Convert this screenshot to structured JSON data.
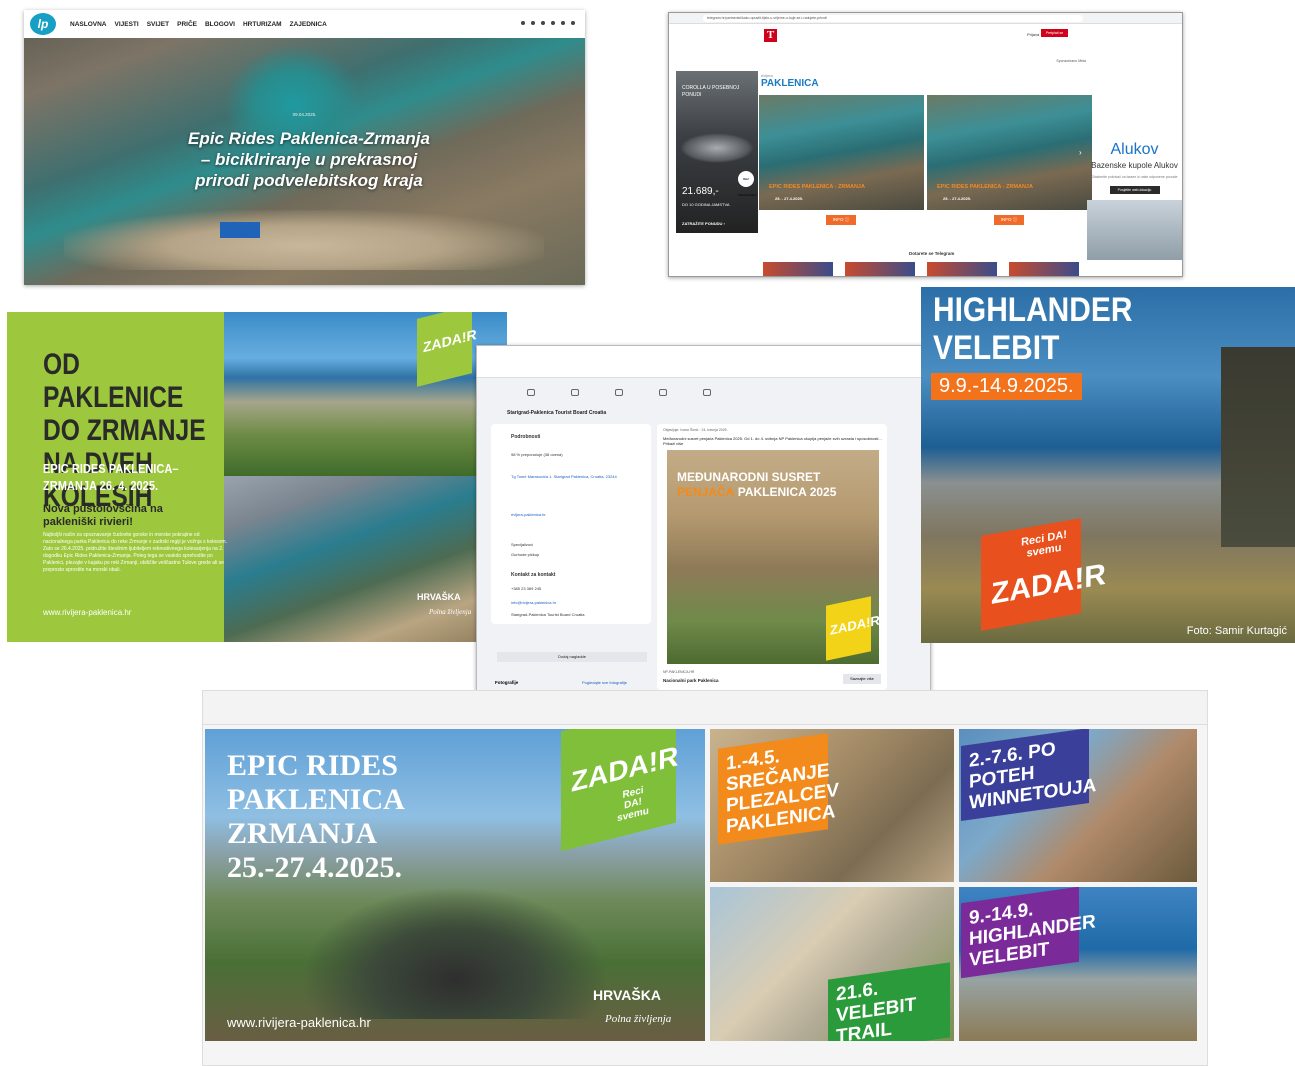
{
  "news_site": {
    "logo": "lp",
    "nav": [
      "NASLOVNA",
      "VIJESTI",
      "SVIJET",
      "PRIČE",
      "BLOGOVI",
      "HRTURIZAM",
      "ZAJEDNICA"
    ],
    "date": "09.04.2025.",
    "headline": "Epic Rides Paklenica-Zrmanja – biciklriranje u prekrasnoj prirodi podvelebitskog kraja"
  },
  "browser_ad_page": {
    "url": "telegram.hr/partnerski/kako-opustit-tijelo-u-vrijeme-u-koje-se-i-radujete-prirodi",
    "login": "Prijava",
    "subscribe": "Pretplati se",
    "sponsored": "Sponzorirano Meta",
    "toyota": {
      "model": "COROLLA U POSEBNOJ PONUDI",
      "price": "21.689,-",
      "warranty": "DO 10 GODINA JAMSTVA",
      "cta": "ZATRAŽITE PONUDU ›",
      "badge": "BEZ ODLAGANJA"
    },
    "brand": {
      "small": "rivijera",
      "name": "PAKLENICA"
    },
    "cards": [
      {
        "title": "EPIC RIDES PAKLENICA - ZRMANJA",
        "date": "25. - 27.4.2025.",
        "button": "INFO ⓘ"
      },
      {
        "title": "EPIC RIDES PAKLENICA - ZRMANJA",
        "date": "25. - 27.4.2025.",
        "button": "INFO ⓘ"
      }
    ],
    "alukov": {
      "name": "Alukov",
      "title": "Bazenske kupole Alukov",
      "desc": "Odaberite pokrivač za bazen iz naše odponene ponude",
      "button": "Posjetite web-lokaciju"
    },
    "telegram": "Dotarete se Telegram"
  },
  "green_ad": {
    "headline": "OD PAKLENICE DO ZRMANJE NA DVEH KOLESIH",
    "event": "EPIC RIDES PAKLENICA–ZRMANJA 26. 4. 2025.",
    "subhead": "Nova pustolovščina na pakleniški rivieri!",
    "body": "Najboljši način za spoznavanje čudovite gorske in morske pokrajine od nacionalnega parka Paklenica do reke Zrmanje v zadrski regiji je vožnja s kolesom. Zato se 26.4.2025. pridružite številnim ljubiteljem rekreativnega kolesarjenja na 2. dogodku Epic Rides Paklenica-Zrmanja. Poleg tega se vsakdo sprehodite po Paklenici, plezajte v kajaku po reki Zrmanji, obiščite veličastno Tulove grede ali se preprosto sprostite na morski obali.",
    "url": "www.rivijera-paklenica.hr",
    "tag": "ZADA!R",
    "hrvatska": "HRVAŠKA",
    "tagline": "Polna življenja"
  },
  "facebook": {
    "page_name": "Starigrad-Paklenica Tourist Board Croatia",
    "about": [
      "Podrobnosti",
      "98 % preporučuje (38 ocena)",
      "Tg Tome Marasovića 1, Starigrad Paklenica, Croatia, 23244",
      "rivijera-paklenica.hr",
      "Specijalizovi",
      "Gurhode pičkup",
      "Kontakt za kontakt",
      "+385 23 369 245",
      "info@rivijera-paklenica.hr",
      "Starigrad-Paklenica Tourist Board Croatia"
    ],
    "add_button": "Dodaj nagladde",
    "photos": "Fotografije",
    "photos_link": "Pogledajte sve fotografije",
    "post_meta": "Objavljuje: Ivana Šimić · 24. travnja 2025.",
    "post_text": "Međunarodni susret penjača Paklenica 2025. Od 1. do 4. svibnja NP Paklenica okuplja penjače svih uzrasta i sposobnosti... Prikaži više",
    "photo_title_a": "MEĐUNARODNI SUSRET",
    "photo_title_b": "PENJAČA",
    "photo_title_c": "PAKLENICA 2025",
    "np_url": "NP-PAKLENICA.HR",
    "np_name": "Nacionalni park Paklenica",
    "more": "Saznajte više"
  },
  "highlander": {
    "title": "HIGHLANDER VELEBIT",
    "dates": "9.9.-14.9.2025.",
    "tag_top": "Reci DA! svemu",
    "tag_zadar": "ZADA!R",
    "credit": "Foto: Samir Kurtagić"
  },
  "collage": {
    "main_title": "EPIC RIDES PAKLENICA ZRMANJA 25.-27.4.2025.",
    "zadar": "ZADA!R",
    "reci": "Reci DA! svemu",
    "url": "www.rivijera-paklenica.hr",
    "hrvatska": "HRVAŠKA",
    "tagline": "Polna življenja",
    "tiles": [
      {
        "label": "1.-4.5. SREČANJE PLEZALCEV PAKLENICA",
        "color": "#f28a1c"
      },
      {
        "label": "2.-7.6. PO POTEH WINNETOUJA",
        "color": "#3a3f9a"
      },
      {
        "label": "21.6. VELEBIT TRAIL",
        "color": "#2a9a3a"
      },
      {
        "label": "9.-14.9. HIGHLANDER VELEBIT",
        "color": "#7b2a9a"
      }
    ]
  }
}
